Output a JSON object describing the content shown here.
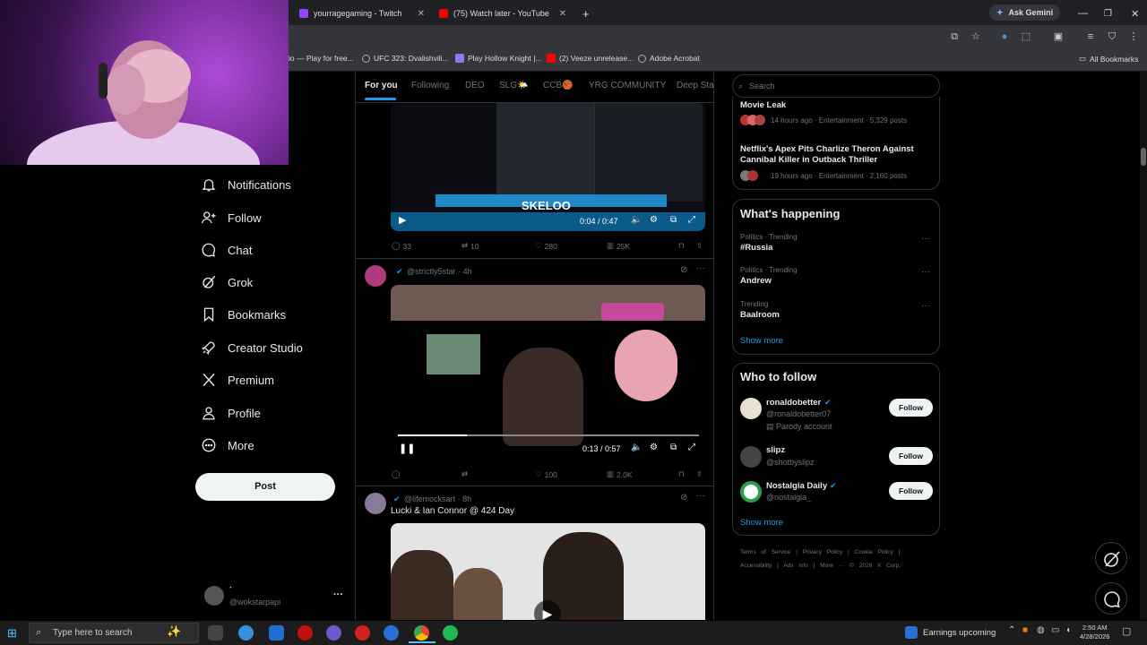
{
  "browser": {
    "tabs": [
      {
        "title": "yourragegaming - Twitch",
        "color": "#9146ff"
      },
      {
        "title": "(75) Watch later - YouTube",
        "color": "#ff0000"
      }
    ],
    "new_tab": "+",
    "ask_gemini": "Ask Gemini",
    "bookmarks": [
      "io — Play for free...",
      "UFC 323: Dvalishvili...",
      "Play Hollow Knight |...",
      "(2) Veeze unrelease...",
      "Adobe Acrobat"
    ],
    "all_bookmarks": "All Bookmarks"
  },
  "nav": {
    "items": [
      "Notifications",
      "Follow",
      "Chat",
      "Grok",
      "Bookmarks",
      "Creator Studio",
      "Premium",
      "Profile",
      "More"
    ],
    "post": "Post",
    "account_name": "ॱ",
    "account_handle": "@wokstarpapi",
    "account_more": "···"
  },
  "feed": {
    "tabs": [
      "For you",
      "Following",
      "DEO",
      "SLG🌤️",
      "CCB🏀",
      "YRG COMMUNITY",
      "Deep Stat"
    ],
    "tweet1": {
      "video_caption": "SKELOO",
      "time": "0:04 / 0:47",
      "replies": "33",
      "reposts": "10",
      "likes": "280",
      "views": "25K"
    },
    "tweet2": {
      "handle": "@strictly5star · 4h",
      "time": "0:13 / 0:57",
      "progress": 0.23,
      "replies": "",
      "reposts": "",
      "likes": "100",
      "views": "2.0K"
    },
    "tweet3": {
      "handle": "@lifemocksart · 8h",
      "text": "Lucki & Ian Connor @ 424 Day"
    }
  },
  "right": {
    "search_placeholder": "Search",
    "news": [
      {
        "title": "Movie Leak",
        "meta": "14 hours ago · Entertainment · 5,329 posts"
      },
      {
        "title": "Netflix's Apex Pits Charlize Theron Against Cannibal Killer in Outback Thriller",
        "meta": "19 hours ago · Entertainment · 2,160 posts"
      }
    ],
    "happening_title": "What's happening",
    "trends": [
      {
        "context": "Politics · Trending",
        "name": "#Russia"
      },
      {
        "context": "Politics · Trending",
        "name": "Andrew"
      },
      {
        "context": "Trending",
        "name": "Baalroom"
      }
    ],
    "show_more": "Show more",
    "wtf_title": "Who to follow",
    "follow": [
      {
        "name": "ronaldobetter",
        "handle": "@ronaldobetter07",
        "extra": "Parody account",
        "verified": true
      },
      {
        "name": "slipz",
        "handle": "@shotbyslipz",
        "extra": "",
        "verified": false
      },
      {
        "name": "Nostalgia Daily",
        "handle": "@nostalgia_",
        "extra": "",
        "verified": true
      }
    ],
    "follow_label": "Follow",
    "footer1": [
      "Terms of Service",
      "|",
      "Privacy Policy",
      "|",
      "Cookie Policy",
      "|"
    ],
    "footer2": [
      "Accessibility",
      "|",
      "Ads info",
      "|",
      "More ···",
      "© 2026 X Corp."
    ]
  },
  "taskbar": {
    "search_placeholder": "Type here to search",
    "earnings": "Earnings upcoming",
    "time": "2:50 AM",
    "date": "4/28/2026"
  },
  "colors": {
    "accent": "#1d9bf0",
    "bg": "#000000",
    "muted": "#71767b",
    "purple": "#9146ff"
  }
}
